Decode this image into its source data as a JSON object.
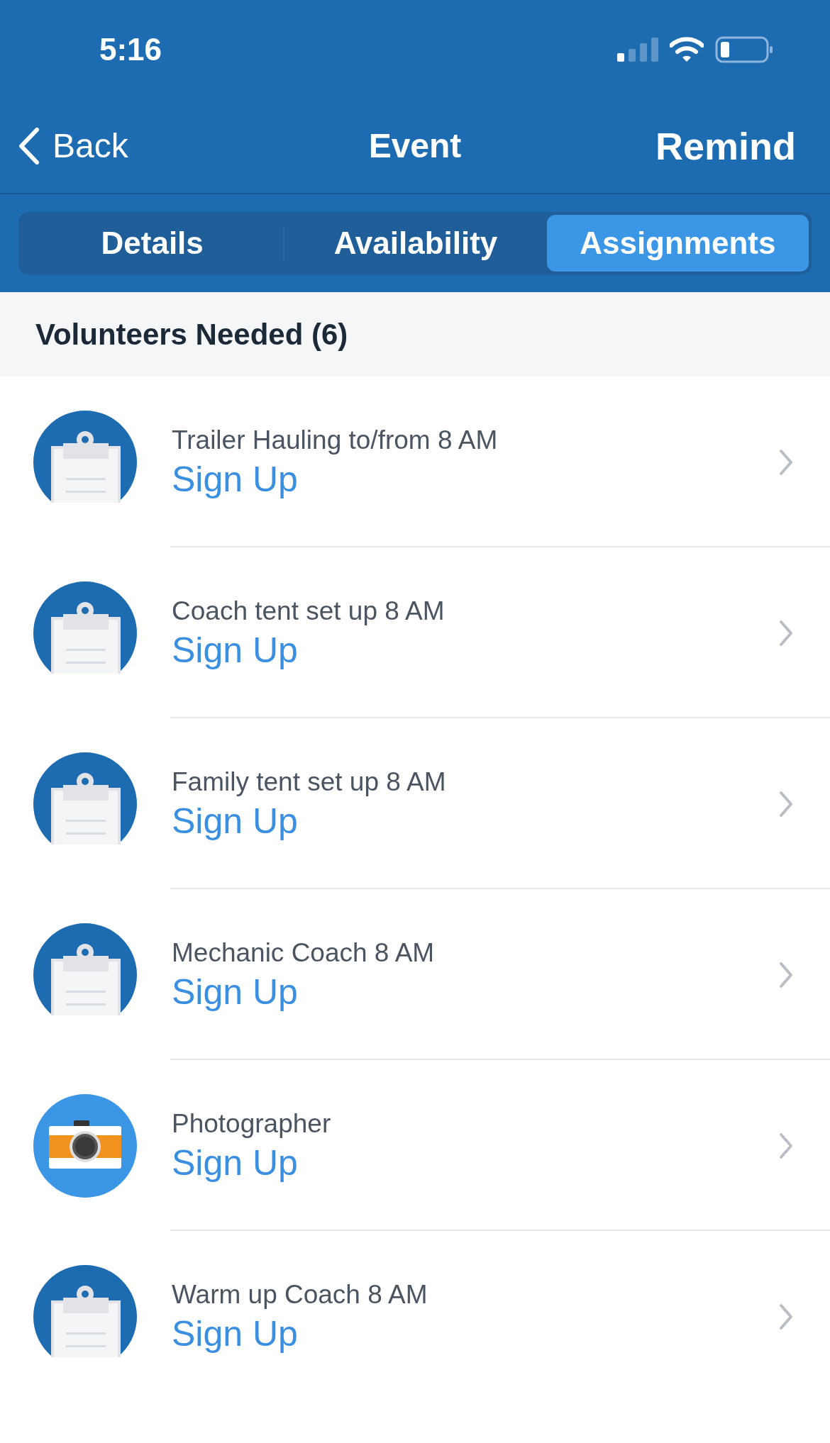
{
  "status_bar": {
    "time": "5:16"
  },
  "nav": {
    "back": "Back",
    "title": "Event",
    "action": "Remind"
  },
  "tabs": [
    {
      "label": "Details",
      "selected": false
    },
    {
      "label": "Availability",
      "selected": false
    },
    {
      "label": "Assignments",
      "selected": true
    }
  ],
  "section": {
    "title": "Volunteers Needed (6)"
  },
  "assignments": [
    {
      "kind": "clipboard",
      "title": "Trailer Hauling to/from 8 AM",
      "action": "Sign Up"
    },
    {
      "kind": "clipboard",
      "title": "Coach tent set up 8 AM",
      "action": "Sign Up"
    },
    {
      "kind": "clipboard",
      "title": "Family tent set up 8 AM",
      "action": "Sign Up"
    },
    {
      "kind": "clipboard",
      "title": "Mechanic Coach 8 AM",
      "action": "Sign Up"
    },
    {
      "kind": "camera",
      "title": "Photographer",
      "action": "Sign Up"
    },
    {
      "kind": "clipboard",
      "title": "Warm up Coach 8 AM",
      "action": "Sign Up"
    }
  ]
}
